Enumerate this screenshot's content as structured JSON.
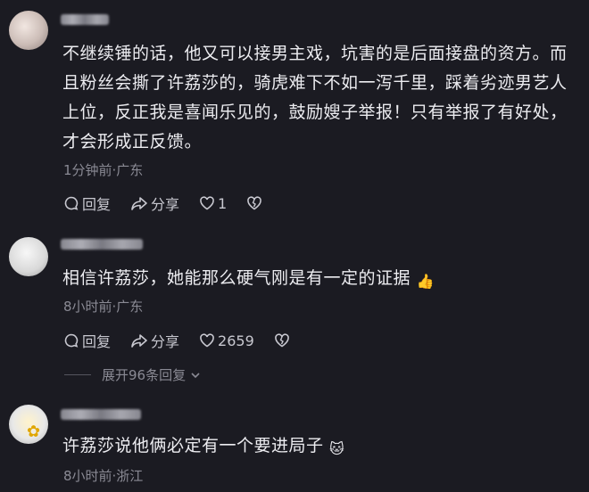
{
  "comments": [
    {
      "text": "不继续锤的话，他又可以接男主戏，坑害的是后面接盘的资方。而且粉丝会撕了许荔莎的，骑虎难下不如一泻千里，踩着劣迹男艺人上位，反正我是喜闻乐见的，鼓励嫂子举报！只有举报了有好处，才会形成正反馈。",
      "meta": "1分钟前·广东",
      "reply_label": "回复",
      "share_label": "分享",
      "like_count": "1"
    },
    {
      "text": "相信许荔莎，她能那么硬气刚是有一定的证据",
      "emoji": "👍",
      "meta": "8小时前·广东",
      "reply_label": "回复",
      "share_label": "分享",
      "like_count": "2659",
      "expand_label": "展开96条回复"
    },
    {
      "text": "许荔莎说他俩必定有一个要进局子",
      "emoji": "🐱",
      "meta": "8小时前·浙江"
    }
  ]
}
